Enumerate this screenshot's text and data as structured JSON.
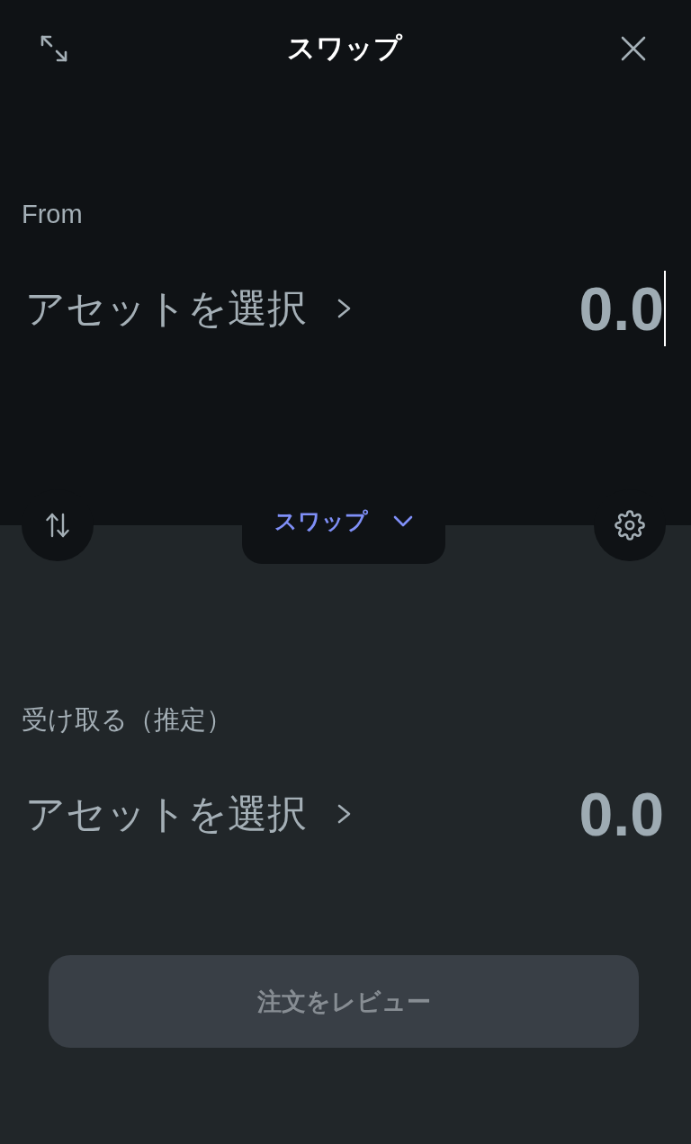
{
  "header": {
    "title": "スワップ"
  },
  "from": {
    "label": "From",
    "asset_button": "アセットを選択",
    "amount": "0.0",
    "focused": true
  },
  "mode_selector": {
    "label": "スワップ"
  },
  "to": {
    "label": "受け取る（推定）",
    "asset_button": "アセットを選択",
    "amount": "0.0",
    "focused": false
  },
  "review_button": {
    "label": "注文をレビュー",
    "disabled": true
  }
}
